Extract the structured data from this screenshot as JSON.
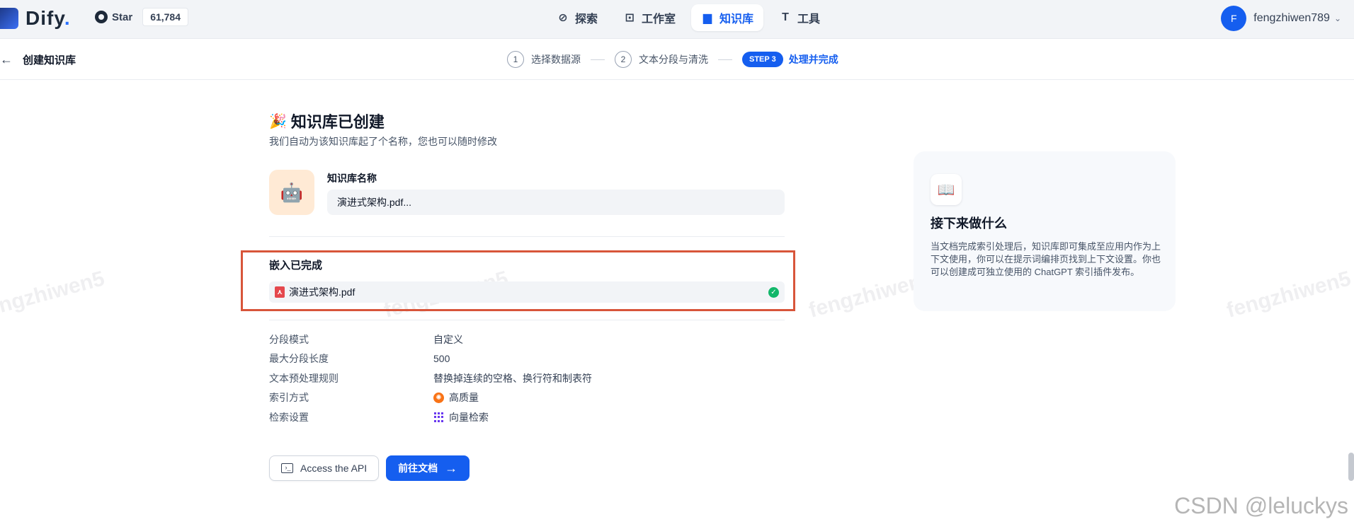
{
  "header": {
    "brand": "Dify",
    "star_label": "Star",
    "star_count": "61,784",
    "nav": [
      {
        "label": "探索",
        "icon": "compass-icon"
      },
      {
        "label": "工作室",
        "icon": "robot-icon"
      },
      {
        "label": "知识库",
        "icon": "book-icon",
        "active": true
      },
      {
        "label": "工具",
        "icon": "hammer-icon"
      }
    ],
    "user": {
      "initial": "F",
      "name": "fengzhiwen789"
    }
  },
  "stepbar": {
    "back_title": "创建知识库",
    "steps": [
      {
        "number": "1",
        "label": "选择数据源"
      },
      {
        "number": "2",
        "label": "文本分段与清洗"
      },
      {
        "badge": "STEP 3",
        "label": "处理并完成"
      }
    ]
  },
  "main": {
    "title": "知识库已创建",
    "title_emoji": "🎉",
    "subtitle": "我们自动为该知识库起了个名称，您也可以随时修改",
    "kb_icon": "🤖",
    "name_label": "知识库名称",
    "name_value": "演进式架构.pdf...",
    "embed_title": "嵌入已完成",
    "file_name": "演进式架构.pdf",
    "info": [
      {
        "key": "分段模式",
        "value": "自定义"
      },
      {
        "key": "最大分段长度",
        "value": "500"
      },
      {
        "key": "文本预处理规则",
        "value": "替换掉连续的空格、换行符和制表符"
      },
      {
        "key": "索引方式",
        "value": "高质量",
        "icon": "high-quality-icon"
      },
      {
        "key": "检索设置",
        "value": "向量检索",
        "icon": "vector-grid-icon"
      }
    ],
    "api_button": "Access the API",
    "docs_button": "前往文档"
  },
  "card": {
    "title": "接下来做什么",
    "body": "当文档完成索引处理后，知识库即可集成至应用内作为上下文使用，你可以在提示词编排页找到上下文设置。你也可以创建成可独立使用的 ChatGPT 索引插件发布。"
  },
  "watermark": "fengzhiwen5",
  "footer_credit": "CSDN @leluckys",
  "colors": {
    "accent": "#155eef",
    "highlight_border": "#d8553a",
    "success": "#12b76a"
  }
}
